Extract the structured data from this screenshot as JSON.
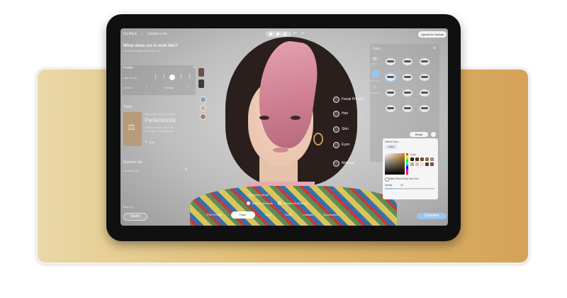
{
  "topbar": {
    "go_back": "Go Back",
    "separator": "|",
    "create_title": "Create a Zoi",
    "upload_button": "Upload to Canvas"
  },
  "heading": {
    "title": "What does zoi in look like?",
    "subtitle": "Create an appearance for zoi."
  },
  "profile": {
    "section_label": "Profile",
    "age_label": "Age Group",
    "gender_label": "Gender",
    "gender_value": "Female"
  },
  "traits": {
    "section_label": "Traits",
    "card_header": "Motivated and Thorough",
    "card_title": "Perfectionist",
    "card_desc": [
      "Values Research and fact",
      "Thorough, Knowledgeable"
    ],
    "edit_label": "Edit"
  },
  "desired_life": {
    "section_label": "Desired Life",
    "value": "Creative Life"
  },
  "left_bottom": {
    "item": "Male UI",
    "studio_button": "Studio"
  },
  "categories": [
    "Facial Presets",
    "Hair",
    "Skin",
    "Eyes",
    "Makeup"
  ],
  "eyes_panel": {
    "title": "Eyes",
    "side_labels": [
      "Eyes",
      "Eyebrows",
      "Eyelashes"
    ],
    "reset_button": "Reset",
    "color_section": {
      "label": "Select Color",
      "chip": "Color",
      "sub_label": "Color",
      "match_label": "Match Whole Body Hair Color",
      "density_label": "density",
      "density_value": "15"
    }
  },
  "swatch_colors": [
    "#2a1c14",
    "#4b3527",
    "#6b4e37",
    "#8b6a4a",
    "#a88863",
    "#c9a37c",
    "#dfc09b",
    "#f0dcc0",
    "#5a3a3a",
    "#7a4a40"
  ],
  "mode_toggles": {
    "symmetry": "Symmetry Mode",
    "basic": "Basic Edit Mode",
    "detailed": "Detailed Edit Mode"
  },
  "bottom_tabs": [
    "Full Presets",
    "Face",
    "Body",
    "Outfit",
    "Catwalk",
    "Accessories"
  ],
  "active_tab": "Face",
  "complete_button": "Complete",
  "accent_color": "#9cc4ef"
}
